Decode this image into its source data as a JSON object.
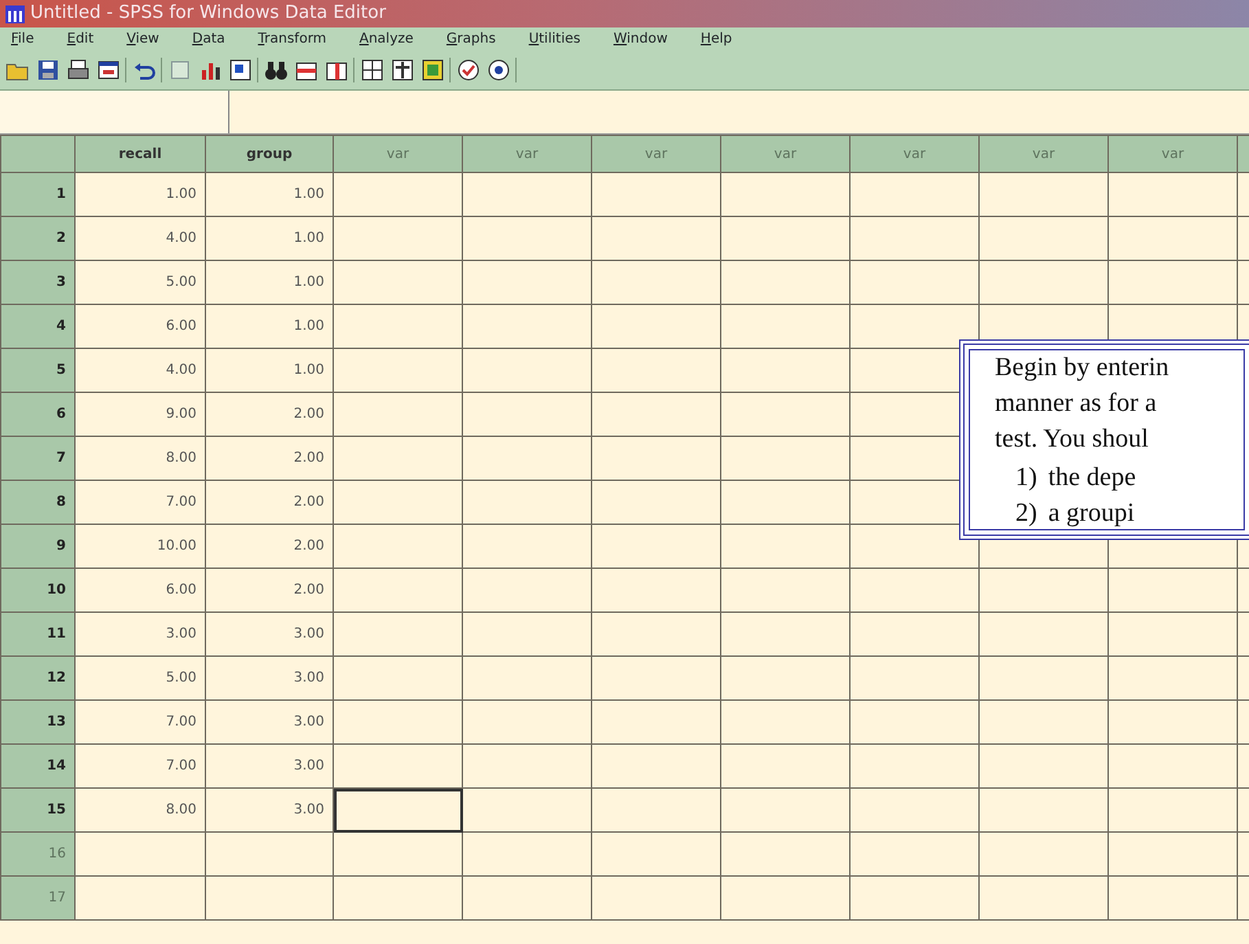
{
  "window": {
    "title": "Untitled - SPSS for Windows Data Editor"
  },
  "menu": [
    "File",
    "Edit",
    "View",
    "Data",
    "Transform",
    "Analyze",
    "Graphs",
    "Utilities",
    "Window",
    "Help"
  ],
  "columns": [
    {
      "name": "recall",
      "defined": true
    },
    {
      "name": "group",
      "defined": true
    },
    {
      "name": "var",
      "defined": false
    },
    {
      "name": "var",
      "defined": false
    },
    {
      "name": "var",
      "defined": false
    },
    {
      "name": "var",
      "defined": false
    },
    {
      "name": "var",
      "defined": false
    },
    {
      "name": "var",
      "defined": false
    },
    {
      "name": "var",
      "defined": false
    }
  ],
  "rows": [
    {
      "number": "1",
      "defined": true,
      "selected": false,
      "values": [
        "1.00",
        "1.00"
      ]
    },
    {
      "number": "2",
      "defined": true,
      "selected": false,
      "values": [
        "4.00",
        "1.00"
      ]
    },
    {
      "number": "3",
      "defined": true,
      "selected": false,
      "values": [
        "5.00",
        "1.00"
      ]
    },
    {
      "number": "4",
      "defined": true,
      "selected": false,
      "values": [
        "6.00",
        "1.00"
      ]
    },
    {
      "number": "5",
      "defined": true,
      "selected": false,
      "values": [
        "4.00",
        "1.00"
      ]
    },
    {
      "number": "6",
      "defined": true,
      "selected": false,
      "values": [
        "9.00",
        "2.00"
      ]
    },
    {
      "number": "7",
      "defined": true,
      "selected": false,
      "values": [
        "8.00",
        "2.00"
      ]
    },
    {
      "number": "8",
      "defined": true,
      "selected": false,
      "values": [
        "7.00",
        "2.00"
      ]
    },
    {
      "number": "9",
      "defined": true,
      "selected": false,
      "values": [
        "10.00",
        "2.00"
      ]
    },
    {
      "number": "10",
      "defined": true,
      "selected": false,
      "values": [
        "6.00",
        "2.00"
      ]
    },
    {
      "number": "11",
      "defined": true,
      "selected": false,
      "values": [
        "3.00",
        "3.00"
      ]
    },
    {
      "number": "12",
      "defined": true,
      "selected": false,
      "values": [
        "5.00",
        "3.00"
      ]
    },
    {
      "number": "13",
      "defined": true,
      "selected": false,
      "values": [
        "7.00",
        "3.00"
      ]
    },
    {
      "number": "14",
      "defined": true,
      "selected": false,
      "values": [
        "7.00",
        "3.00"
      ]
    },
    {
      "number": "15",
      "defined": true,
      "selected": true,
      "values": [
        "8.00",
        "3.00"
      ]
    },
    {
      "number": "16",
      "defined": false,
      "selected": false,
      "values": []
    },
    {
      "number": "17",
      "defined": false,
      "selected": false,
      "values": []
    }
  ],
  "callout": {
    "lines": [
      "Begin by enterin",
      "manner as for a",
      "test.  You shoul"
    ],
    "list": [
      {
        "marker": "1)",
        "text": "the depe"
      },
      {
        "marker": "2)",
        "text": "a groupi"
      }
    ]
  }
}
